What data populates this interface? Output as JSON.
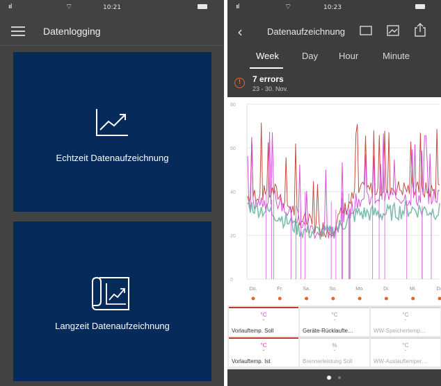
{
  "left": {
    "status": {
      "time": "10:21",
      "carrier": "ııl"
    },
    "header": {
      "title": "Datenlogging"
    },
    "tiles": [
      {
        "label": "Echtzeit Datenaufzeichnung",
        "icon": "line-chart-icon"
      },
      {
        "label": "Langzeit Datenaufzeichnung",
        "icon": "scroll-chart-icon"
      }
    ]
  },
  "right": {
    "status": {
      "time": "10:23",
      "carrier": "ııl"
    },
    "header": {
      "title": "Datenaufzeichnung",
      "back": "‹"
    },
    "tabs": [
      {
        "label": "Week",
        "active": true
      },
      {
        "label": "Day",
        "active": false
      },
      {
        "label": "Hour",
        "active": false
      },
      {
        "label": "Minute",
        "active": false
      }
    ],
    "errors": {
      "title": "7 errors",
      "date": "23 - 30. Nov.",
      "icon": "!"
    },
    "cards": [
      {
        "unit": "°C",
        "value": "-",
        "label": "Vorlauftemp. Soll",
        "active": true
      },
      {
        "unit": "°C",
        "value": "-",
        "label": "Geräte-Rücklaufte…",
        "active": false
      },
      {
        "unit": "°C",
        "value": "-",
        "label": "WW-Speichertemp…",
        "active": false
      },
      {
        "unit": "°C",
        "value": "-",
        "label": "Vorlauftemp. Ist",
        "active": true
      },
      {
        "unit": "%",
        "value": "-",
        "label": "Brennerleistung Soll",
        "active": false
      },
      {
        "unit": "°C",
        "value": "-",
        "label": "WW-Auslauftemper…",
        "active": false
      }
    ],
    "pager": {
      "pages": 2,
      "current": 1
    }
  },
  "chart_data": {
    "type": "line",
    "title": "",
    "xlabel": "",
    "ylabel": "",
    "y_ticks": [
      "80",
      "60",
      "40",
      "20",
      "0"
    ],
    "ylim": [
      0,
      80
    ],
    "categories": [
      "Do.",
      "Fr.",
      "Sa.",
      "So.",
      "Mo.",
      "Di.",
      "Mi.",
      "Do"
    ],
    "series": [
      {
        "color": "#c0392b",
        "values": [
          38,
          40,
          27,
          22,
          40,
          42,
          41,
          40
        ]
      },
      {
        "color": "#d23fd2",
        "values": [
          35,
          37,
          24,
          20,
          36,
          38,
          37,
          38
        ]
      },
      {
        "color": "#5fae9a",
        "values": [
          34,
          30,
          22,
          21,
          30,
          30,
          32,
          31
        ]
      }
    ],
    "error_markers": [
      "Do.",
      "Fr.",
      "Sa.",
      "So.",
      "Mo.",
      "Di.",
      "Mi.",
      "Do"
    ],
    "colors": {
      "error_marker": "#e0662e",
      "grid": "#e6e6e6"
    }
  }
}
